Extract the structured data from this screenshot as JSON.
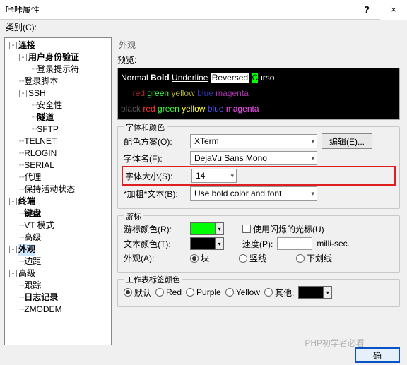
{
  "window": {
    "title": "咔咔属性",
    "help": "?",
    "close": "×"
  },
  "category_label": "类别(C):",
  "tree": {
    "conn": "连接",
    "auth": "用户身份验证",
    "prompt": "登录提示符",
    "script": "登录脚本",
    "ssh": "SSH",
    "sec": "安全性",
    "tunnel": "隧道",
    "sftp": "SFTP",
    "telnet": "TELNET",
    "rlogin": "RLOGIN",
    "serial": "SERIAL",
    "proxy": "代理",
    "keep": "保持活动状态",
    "term": "终端",
    "kb": "键盘",
    "vt": "VT 模式",
    "adv": "高级",
    "appear": "外观",
    "margin": "边距",
    "adv2": "高级",
    "trace": "跟踪",
    "log": "日志记录",
    "zmodem": "ZMODEM"
  },
  "right_title": "外观",
  "preview_label": "预览:",
  "preview": {
    "normal": "Normal",
    "bold": "Bold",
    "under": "Underline",
    "rev": "Reversed",
    "cur": "C",
    "urso": "urso",
    "red": "red",
    "green": "green",
    "yellow": "yellow",
    "blue": "blue",
    "magenta": "magenta",
    "black": "black"
  },
  "font_group": "字体和颜色",
  "scheme_label": "配色方案(O):",
  "scheme_value": "XTerm",
  "edit_btn": "编辑(E)...",
  "fontname_label": "字体名(F):",
  "fontname_value": "DejaVu Sans Mono",
  "fontsize_label": "字体大小(S):",
  "fontsize_value": "14",
  "boldtext_label": "*加粗*文本(B):",
  "boldtext_value": "Use bold color and font",
  "cursor_group": "游标",
  "cursorcolor_label": "游标颜色(R):",
  "blink_label": "使用闪烁的光标(U)",
  "textcolor_label": "文本颜色(T):",
  "speed_label": "速度(P):",
  "ms": "milli-sec.",
  "appearance_label": "外观(A):",
  "rad_block": "块",
  "rad_vert": "竖线",
  "rad_under": "下划线",
  "tab_group": "工作表标签颜色",
  "rad_default": "默认",
  "rad_red": "Red",
  "rad_purple": "Purple",
  "rad_yellow": "Yellow",
  "rad_other": "其他:",
  "ok": "确",
  "watermark": "PHP初学者必看"
}
